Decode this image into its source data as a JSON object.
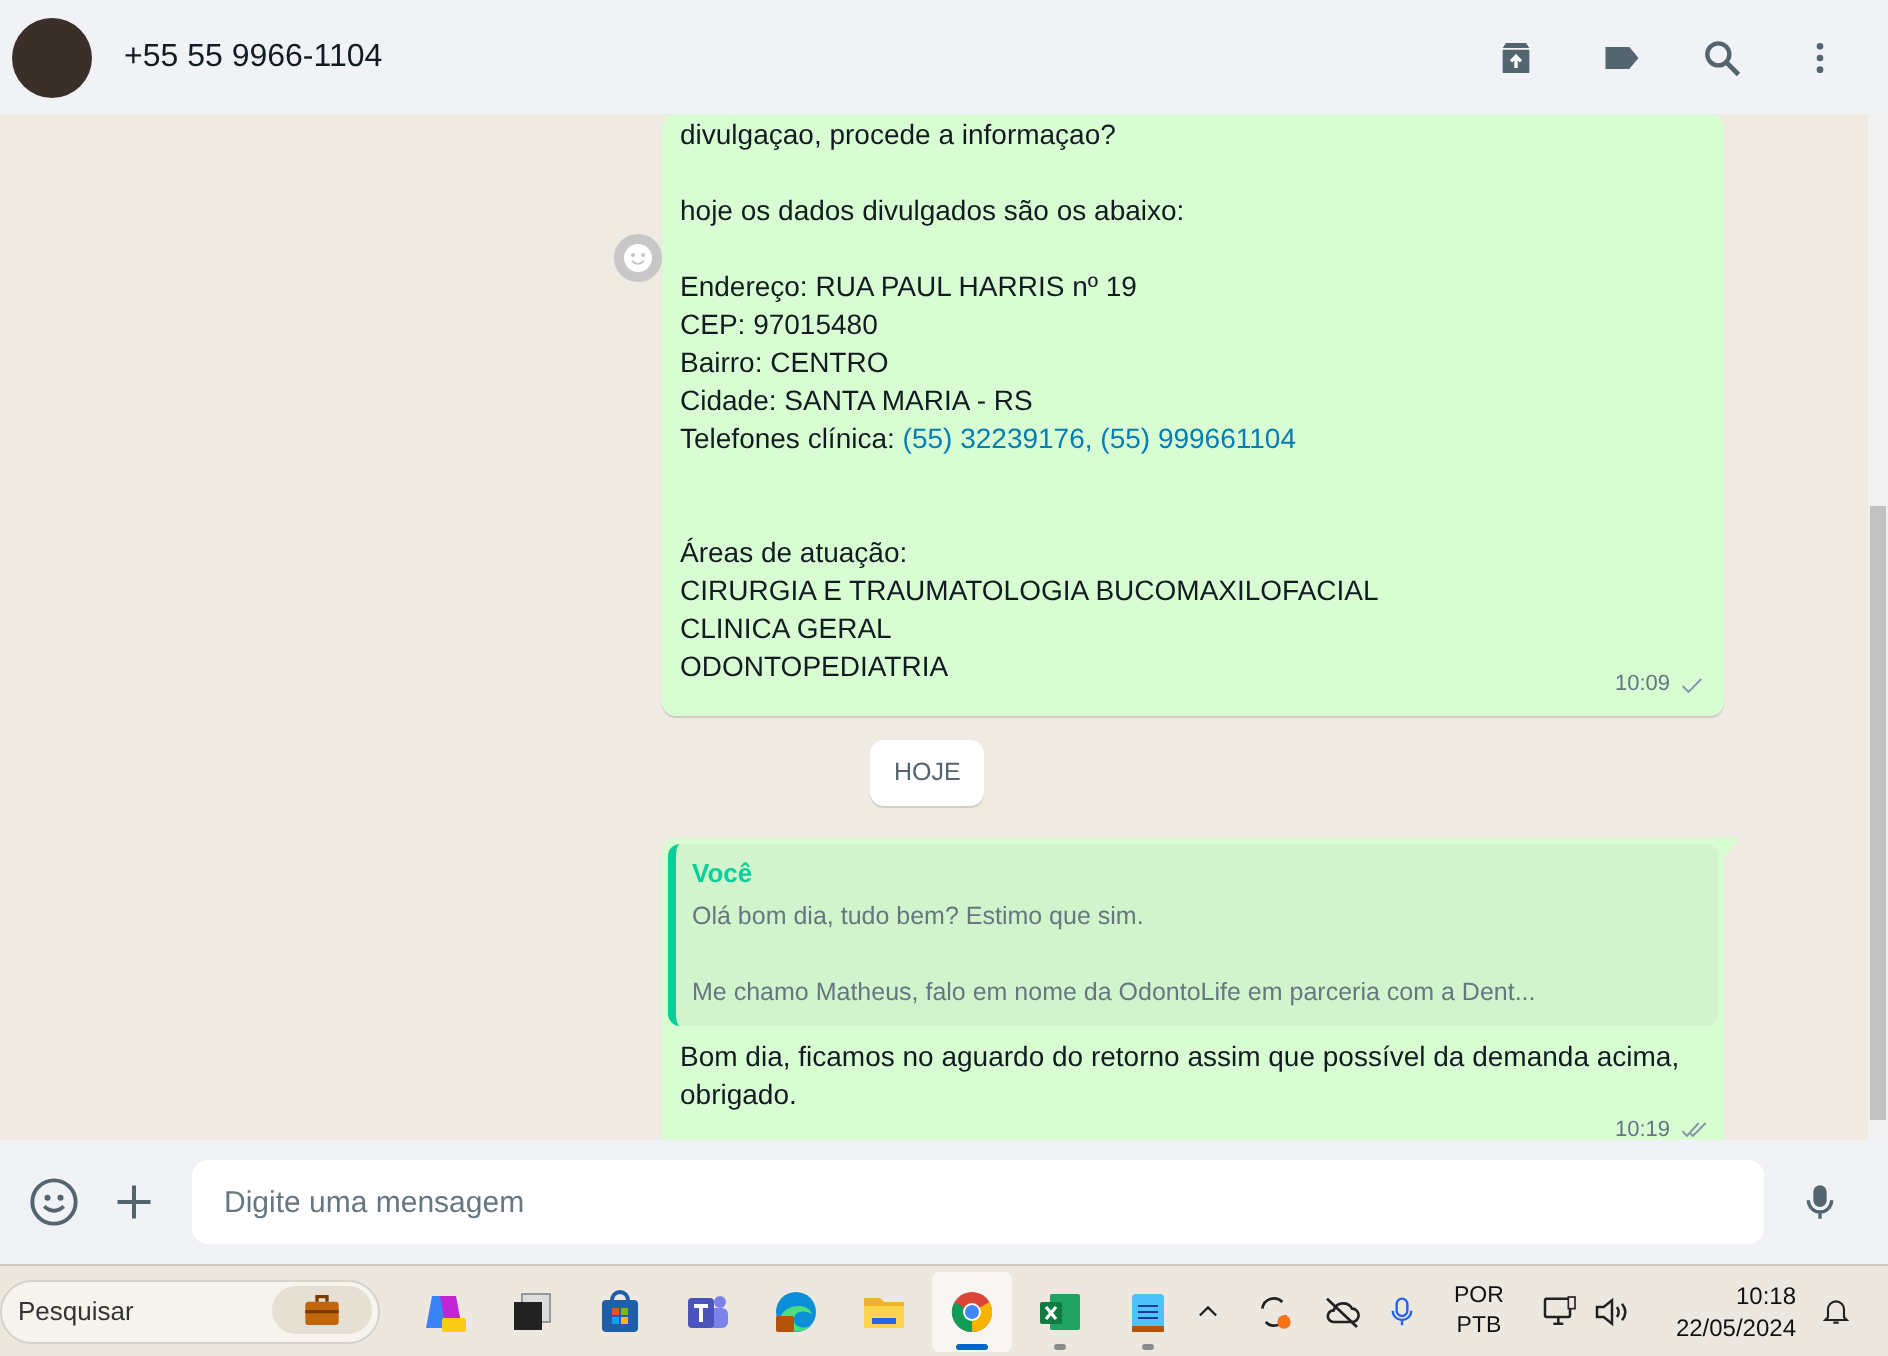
{
  "header": {
    "contact": "+55 55 9966-1104"
  },
  "messages": [
    {
      "kind": "text",
      "delivered": false,
      "time": "10:09",
      "paragraphs": [
        {
          "lines": [
            [
              {
                "text": "divulgaçao, procede a informaçao?",
                "link": false
              }
            ]
          ]
        },
        {
          "lines": [
            [
              {
                "text": "hoje os dados divulgados são os abaixo:",
                "link": false
              }
            ]
          ]
        },
        {
          "lines": [
            [
              {
                "text": "Endereço: RUA PAUL HARRIS nº 19",
                "link": false
              }
            ],
            [
              {
                "text": "CEP: 97015480",
                "link": false
              }
            ],
            [
              {
                "text": "Bairro: CENTRO",
                "link": false
              }
            ],
            [
              {
                "text": "Cidade: SANTA MARIA - RS",
                "link": false
              }
            ],
            [
              {
                "text": "Telefones clínica: ",
                "link": false
              },
              {
                "text": "(55) 32239176,",
                "link": true
              },
              {
                "text": "(55) 999661104",
                "link": true
              }
            ]
          ]
        },
        {
          "lines": [
            [
              {
                "text": "Áreas de atuação:",
                "link": false
              }
            ],
            [
              {
                "text": "CIRURGIA E TRAUMATOLOGIA BUCOMAXILOFACIAL",
                "link": false
              }
            ],
            [
              {
                "text": "CLINICA GERAL",
                "link": false
              }
            ],
            [
              {
                "text": "ODONTOPEDIATRIA",
                "link": false
              }
            ]
          ]
        }
      ]
    },
    {
      "kind": "date",
      "label": "HOJE"
    },
    {
      "kind": "reply",
      "delivered": true,
      "time": "10:19",
      "quote": {
        "author": "Você",
        "lines": [
          "Olá bom dia, tudo bem? Estimo que sim.",
          "Me chamo Matheus, falo em nome da OdontoLife em parceria com a Dent..."
        ]
      },
      "body": [
        "Bom dia, ficamos no aguardo do retorno assim que possível da demanda acima,",
        "obrigado."
      ]
    }
  ],
  "composer": {
    "placeholder": "Digite uma mensagem"
  },
  "taskbar": {
    "search": {
      "placeholder": "Pesquisar"
    },
    "apps": [
      {
        "kind": "copilot",
        "selected": false,
        "running": false
      },
      {
        "kind": "taskview",
        "selected": false,
        "running": false
      },
      {
        "kind": "store",
        "selected": false,
        "running": false
      },
      {
        "kind": "teams",
        "selected": false,
        "running": false
      },
      {
        "kind": "edge",
        "selected": false,
        "running": false
      },
      {
        "kind": "folder",
        "selected": false,
        "running": false
      },
      {
        "kind": "chrome",
        "selected": true,
        "running": true
      },
      {
        "kind": "excel",
        "selected": false,
        "running": true
      },
      {
        "kind": "notepad",
        "selected": false,
        "running": true
      }
    ],
    "language": [
      "POR",
      "PTB"
    ],
    "time": "10:18",
    "date": "22/05/2024"
  }
}
